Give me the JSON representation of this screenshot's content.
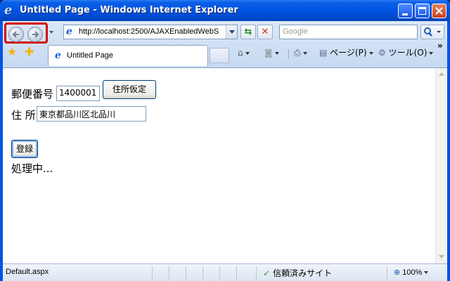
{
  "window": {
    "title": "Untitled Page - Windows Internet Explorer",
    "minimize_icon": "minimize-icon",
    "maximize_icon": "maximize-icon",
    "close_icon": "close-icon"
  },
  "toolbar": {
    "address_url": "http://localhost:2500/AJAXEnabledWebS",
    "search_placeholder": "Google",
    "refresh_icon": "refresh-icon",
    "stop_icon": "stop-icon",
    "search_icon": "search-icon"
  },
  "tabs": [
    {
      "label": "Untitled Page"
    }
  ],
  "commands": {
    "page": "ページ(P)",
    "tools": "ツール(O)"
  },
  "form": {
    "postal_label": "郵便番号",
    "postal_value": "1400001",
    "lookup_button": "住所仮定",
    "address_label": "住 所",
    "address_value": "東京都品川区北品川",
    "submit_button": "登録",
    "processing_text": "処理中..."
  },
  "statusbar": {
    "text": "Default.aspx",
    "zone": "信頼済みサイト",
    "zoom": "100%"
  },
  "colors": {
    "titlebar": "#0254e0",
    "highlight_box": "#d40000",
    "toolbar": "#dbe8f8"
  }
}
